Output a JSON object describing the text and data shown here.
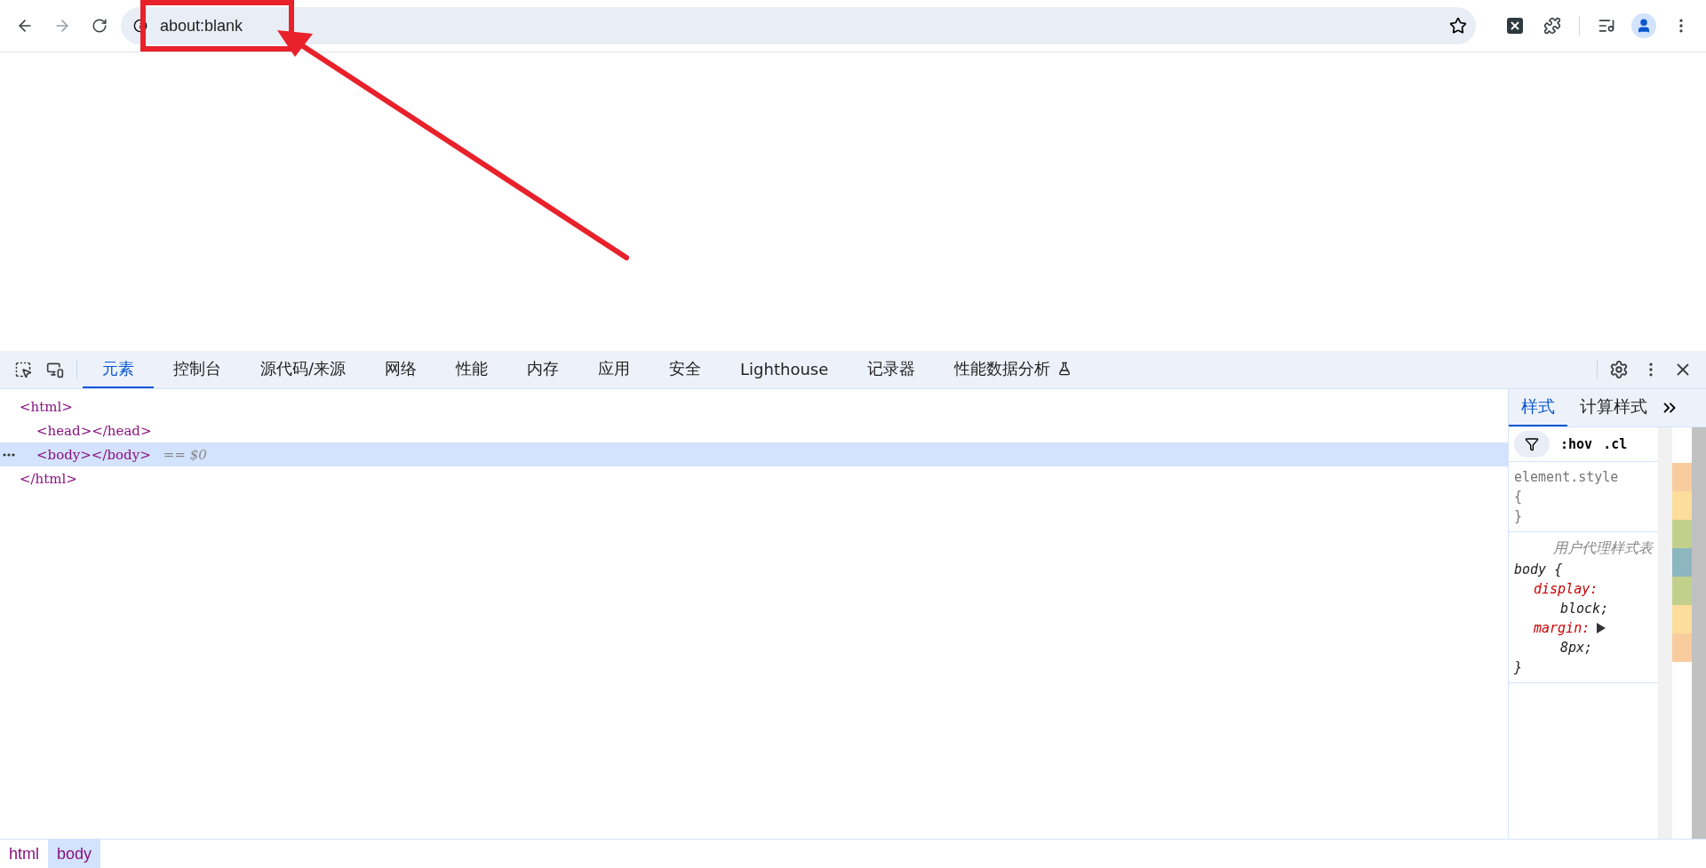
{
  "browser": {
    "url": "about:blank",
    "bookmarked": false
  },
  "devtools": {
    "tabs": [
      {
        "label": "元素",
        "selected": true,
        "kind": "plain"
      },
      {
        "label": "控制台",
        "selected": false,
        "kind": "plain"
      },
      {
        "label": "源代码/来源",
        "selected": false,
        "kind": "plain"
      },
      {
        "label": "网络",
        "selected": false,
        "kind": "plain"
      },
      {
        "label": "性能",
        "selected": false,
        "kind": "plain"
      },
      {
        "label": "内存",
        "selected": false,
        "kind": "plain"
      },
      {
        "label": "应用",
        "selected": false,
        "kind": "plain"
      },
      {
        "label": "安全",
        "selected": false,
        "kind": "plain"
      },
      {
        "label": "Lighthouse",
        "selected": false,
        "kind": "plain"
      },
      {
        "label": "记录器",
        "selected": false,
        "kind": "plain"
      },
      {
        "label": "性能数据分析",
        "selected": false,
        "kind": "experimental"
      }
    ],
    "elements": [
      {
        "open": "<html>",
        "close": "</html>",
        "selected": false,
        "children": [
          {
            "open": "<head></head>",
            "selected": false
          },
          {
            "open": "<body></body>",
            "selected": true,
            "note": "== $0"
          }
        ]
      }
    ],
    "styles": {
      "tabs": [
        {
          "label": "样式",
          "selected": true
        },
        {
          "label": "计算样式",
          "selected": false
        }
      ],
      "filter_buttons": [
        ":hov",
        ".cl"
      ],
      "element_style": {
        "selector": "element.style",
        "open": "{",
        "close": "}"
      },
      "rules": [
        {
          "origin": "用户代理样式表",
          "selector": "body {",
          "close": "}",
          "declarations": [
            {
              "property": "display:",
              "value": "block;",
              "expandable": false
            },
            {
              "property": "margin:",
              "value": "8px;",
              "expandable": true
            }
          ]
        }
      ]
    },
    "breadcrumbs": [
      {
        "label": "html",
        "selected": false
      },
      {
        "label": "body",
        "selected": true
      }
    ]
  }
}
